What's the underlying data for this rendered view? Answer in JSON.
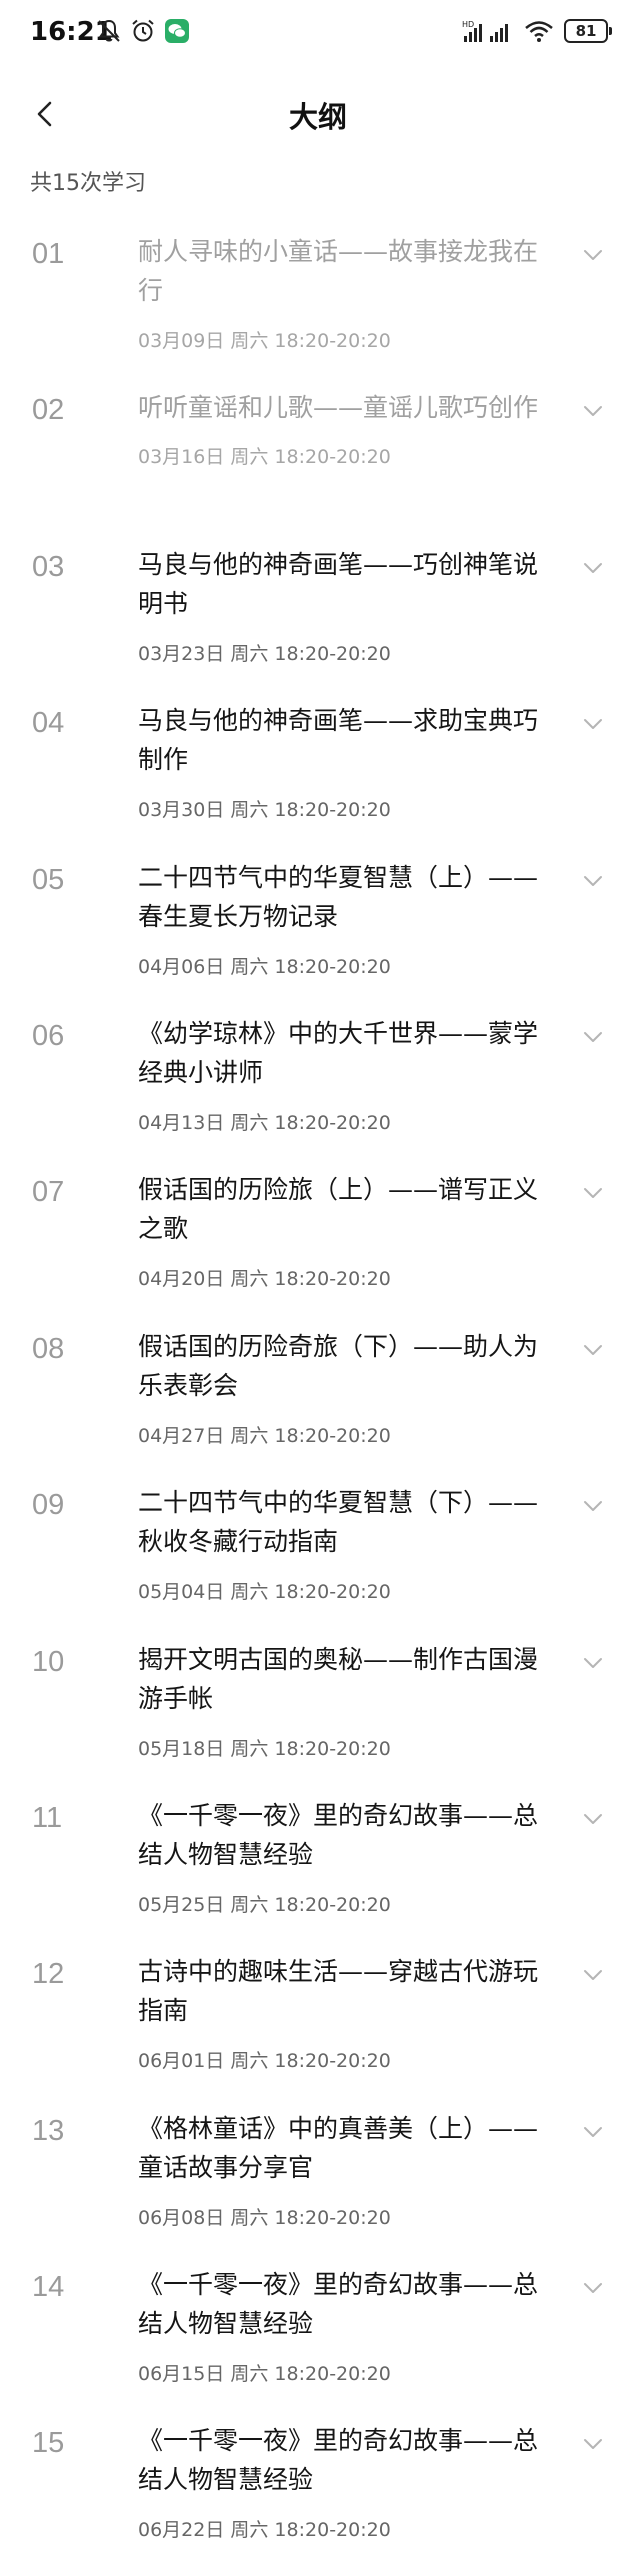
{
  "status": {
    "time": "16:21",
    "battery": "81",
    "network_label": "HD"
  },
  "nav": {
    "title": "大纲"
  },
  "summary": "共15次学习",
  "lessons": [
    {
      "num": "01",
      "title": "耐人寻味的小童话——故事接龙我在行",
      "time": "03月09日 周六 18:20-20:20",
      "muted": true,
      "lines": 2
    },
    {
      "num": "02",
      "title": "听听童谣和儿歌——童谣儿歌巧创作",
      "time": "03月16日 周六 18:20-20:20",
      "muted": true,
      "lines": 1
    },
    {
      "num": "03",
      "title": "马良与他的神奇画笔——巧创神笔说明书",
      "time": "03月23日 周六 18:20-20:20",
      "muted": false,
      "lines": 2
    },
    {
      "num": "04",
      "title": "马良与他的神奇画笔——求助宝典巧制作",
      "time": "03月30日 周六 18:20-20:20",
      "muted": false,
      "lines": 2
    },
    {
      "num": "05",
      "title": "二十四节气中的华夏智慧（上）——春生夏长万物记录",
      "time": "04月06日 周六 18:20-20:20",
      "muted": false,
      "lines": 2
    },
    {
      "num": "06",
      "title": "《幼学琼林》中的大千世界——蒙学经典小讲师",
      "time": "04月13日 周六 18:20-20:20",
      "muted": false,
      "lines": 2
    },
    {
      "num": "07",
      "title": "假话国的历险旅（上）——谱写正义之歌",
      "time": "04月20日 周六 18:20-20:20",
      "muted": false,
      "lines": 2
    },
    {
      "num": "08",
      "title": "假话国的历险奇旅（下）——助人为乐表彰会",
      "time": "04月27日 周六 18:20-20:20",
      "muted": false,
      "lines": 2
    },
    {
      "num": "09",
      "title": "二十四节气中的华夏智慧（下）——秋收冬藏行动指南",
      "time": "05月04日 周六 18:20-20:20",
      "muted": false,
      "lines": 2
    },
    {
      "num": "10",
      "title": "揭开文明古国的奥秘——制作古国漫游手帐",
      "time": "05月18日 周六 18:20-20:20",
      "muted": false,
      "lines": 2
    },
    {
      "num": "11",
      "title": "《一千零一夜》里的奇幻故事——总结人物智慧经验",
      "time": "05月25日 周六 18:20-20:20",
      "muted": false,
      "lines": 2
    },
    {
      "num": "12",
      "title": "古诗中的趣味生活——穿越古代游玩指南",
      "time": "06月01日 周六 18:20-20:20",
      "muted": false,
      "lines": 2
    },
    {
      "num": "13",
      "title": "《格林童话》中的真善美（上）——童话故事分享官",
      "time": "06月08日 周六 18:20-20:20",
      "muted": false,
      "lines": 2
    },
    {
      "num": "14",
      "title": "《一千零一夜》里的奇幻故事——总结人物智慧经验",
      "time": "06月15日 周六 18:20-20:20",
      "muted": false,
      "lines": 2
    },
    {
      "num": "15",
      "title": "《一千零一夜》里的奇幻故事——总结人物智慧经验",
      "time": "06月22日 周六 18:20-20:20",
      "muted": false,
      "lines": 2
    }
  ],
  "colors": {
    "text": "#151515",
    "muted_text": "#a0a0a0",
    "number": "#9a9a9a",
    "background": "#ffffff"
  },
  "icons": {
    "back": "chevron-left-icon",
    "expand": "chevron-down-icon"
  }
}
